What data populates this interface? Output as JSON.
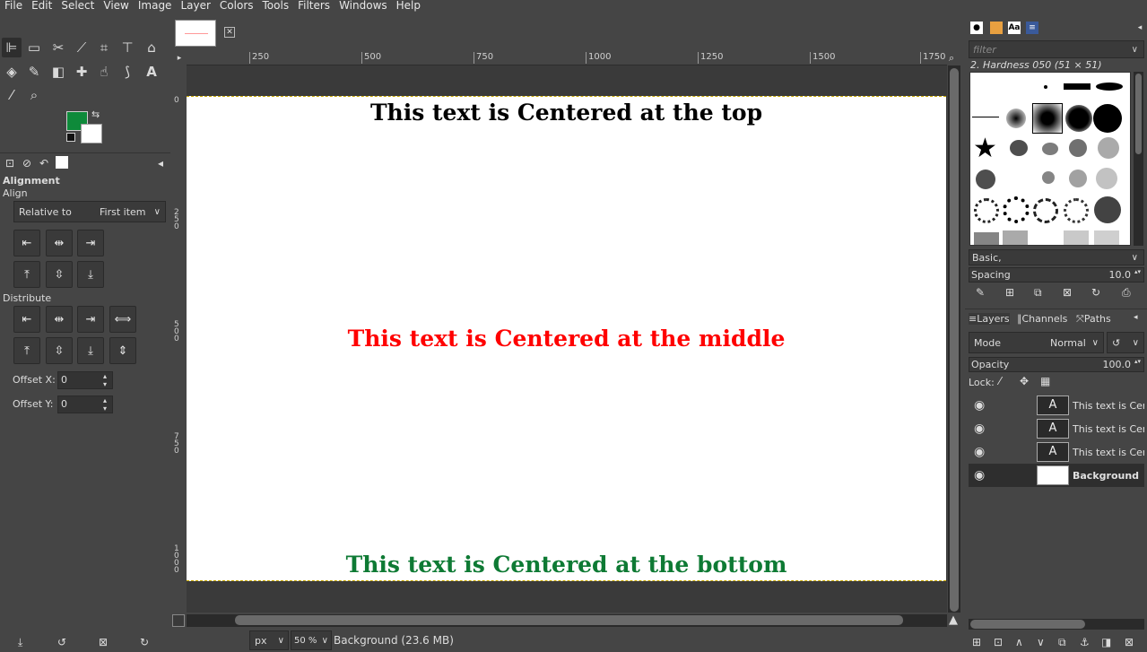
{
  "menu": [
    "File",
    "Edit",
    "Select",
    "View",
    "Image",
    "Layer",
    "Colors",
    "Tools",
    "Filters",
    "Windows",
    "Help"
  ],
  "colors": {
    "foreground": "#0e8a3a",
    "background": "#ffffff"
  },
  "alignment": {
    "title": "Alignment",
    "align_label": "Align",
    "relative_to_label": "Relative to",
    "relative_to_value": "First item",
    "distribute_label": "Distribute",
    "offset_x_label": "Offset X:",
    "offset_x_value": "0",
    "offset_y_label": "Offset Y:",
    "offset_y_value": "0"
  },
  "ruler_top": [
    "250",
    "500",
    "750",
    "1000",
    "1250",
    "1500",
    "1750"
  ],
  "ruler_left": [
    "0",
    "250",
    "500",
    "750",
    "1000"
  ],
  "canvas": {
    "top_text": "This text is Centered at the top",
    "top_color": "#000000",
    "middle_text": "This text is Centered at the middle",
    "middle_color": "#ff0000",
    "bottom_text": "This text is Centered at the bottom",
    "bottom_color": "#0e7a34"
  },
  "status": {
    "unit": "px",
    "zoom": "50 %",
    "info": "Background (23.6 MB)"
  },
  "brushes": {
    "filter_placeholder": "filter",
    "selected": "2. Hardness 050 (51 × 51)",
    "tag": "Basic,",
    "spacing_label": "Spacing",
    "spacing_value": "10.0"
  },
  "layers_panel": {
    "tabs": [
      "Layers",
      "Channels",
      "Paths"
    ],
    "mode_label": "Mode",
    "mode_value": "Normal",
    "opacity_label": "Opacity",
    "opacity_value": "100.0",
    "lock_label": "Lock:",
    "layers": [
      {
        "name": "This text is Centered at the top",
        "type": "text",
        "selected": false
      },
      {
        "name": "This text is Centered at the middle",
        "type": "text",
        "selected": false
      },
      {
        "name": "This text is Centered at the bottom",
        "type": "text",
        "selected": false
      },
      {
        "name": "Background",
        "type": "image",
        "selected": true
      }
    ]
  }
}
